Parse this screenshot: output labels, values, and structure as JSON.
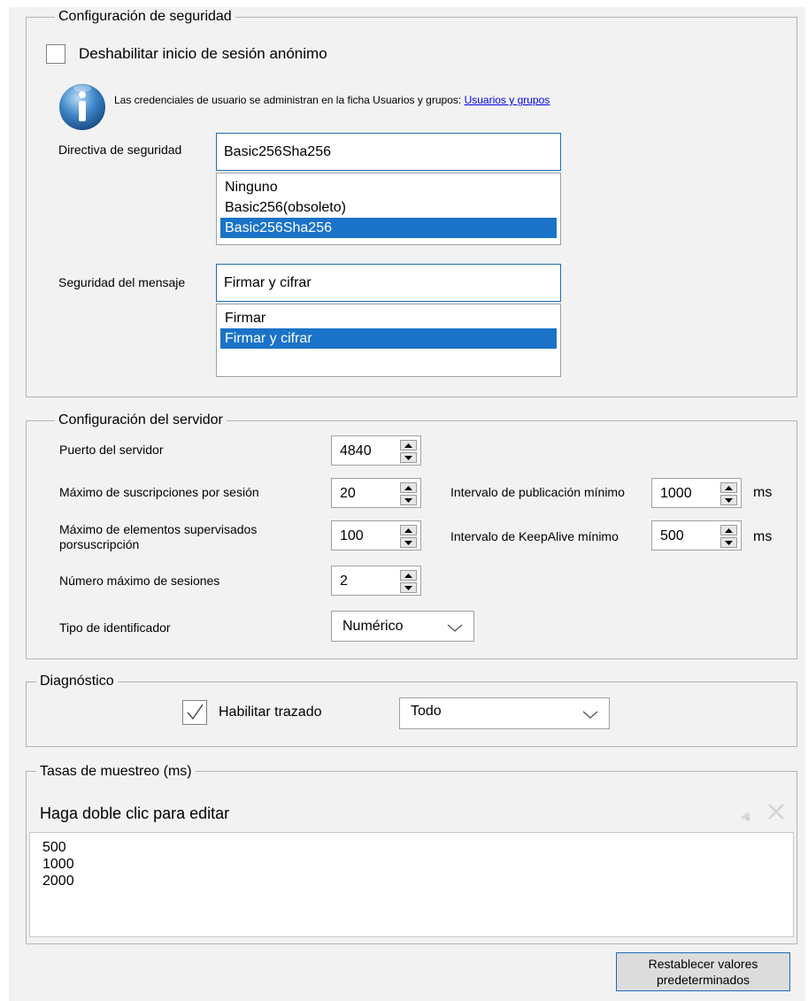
{
  "security": {
    "legend": "Configuración de seguridad",
    "anon_checkbox_label": "Deshabilitar inicio de sesión anónimo",
    "anon_checked": false,
    "info_text": "Las credenciales de usuario se administran en la ficha Usuarios y grupos:",
    "info_link": "Usuarios y grupos",
    "policy_label": "Directiva de seguridad",
    "policy_value": "Basic256Sha256",
    "policy_options": [
      "Ninguno",
      "Basic256(obsoleto)",
      "Basic256Sha256"
    ],
    "message_label": "Seguridad del mensaje",
    "message_value": "Firmar y cifrar",
    "message_options": [
      "Firmar",
      "Firmar y cifrar"
    ]
  },
  "server": {
    "legend": "Configuración del servidor",
    "port_label": "Puerto del servidor",
    "port_value": "4840",
    "max_subs_label": "Máximo de suscripciones por sesión",
    "max_subs_value": "20",
    "max_items_label_1": "Máximo de elementos supervisados",
    "max_items_label_2": "porsuscripción",
    "max_items_value": "100",
    "max_sessions_label": "Número máximo de sesiones",
    "max_sessions_value": "2",
    "id_type_label": "Tipo de identificador",
    "id_type_value": "Numérico",
    "pub_interval_label": "Intervalo de publicación mínimo",
    "pub_interval_value": "1000",
    "pub_interval_unit": "ms",
    "keepalive_label": "Intervalo de KeepAlive mínimo",
    "keepalive_value": "500",
    "keepalive_unit": "ms"
  },
  "diagnostics": {
    "legend": "Diagnóstico",
    "trace_label": "Habilitar trazado",
    "trace_checked": true,
    "trace_level": "Todo"
  },
  "sampling": {
    "legend": "Tasas de muestreo (ms)",
    "header": "Haga doble clic para editar",
    "rates": [
      "500",
      "1000",
      "2000"
    ]
  },
  "reset_button": {
    "line1": "Restablecer valores",
    "line2": "predeterminados"
  },
  "colors": {
    "panel_bg": "#f2f2f2",
    "selection": "#1a73c8",
    "focus_border": "#1a6eb8",
    "link": "#0000ee"
  },
  "icons": [
    "info-icon",
    "checkmark-icon",
    "spin-up-icon",
    "spin-down-icon",
    "chevron-down-icon",
    "add-icon",
    "delete-icon"
  ]
}
